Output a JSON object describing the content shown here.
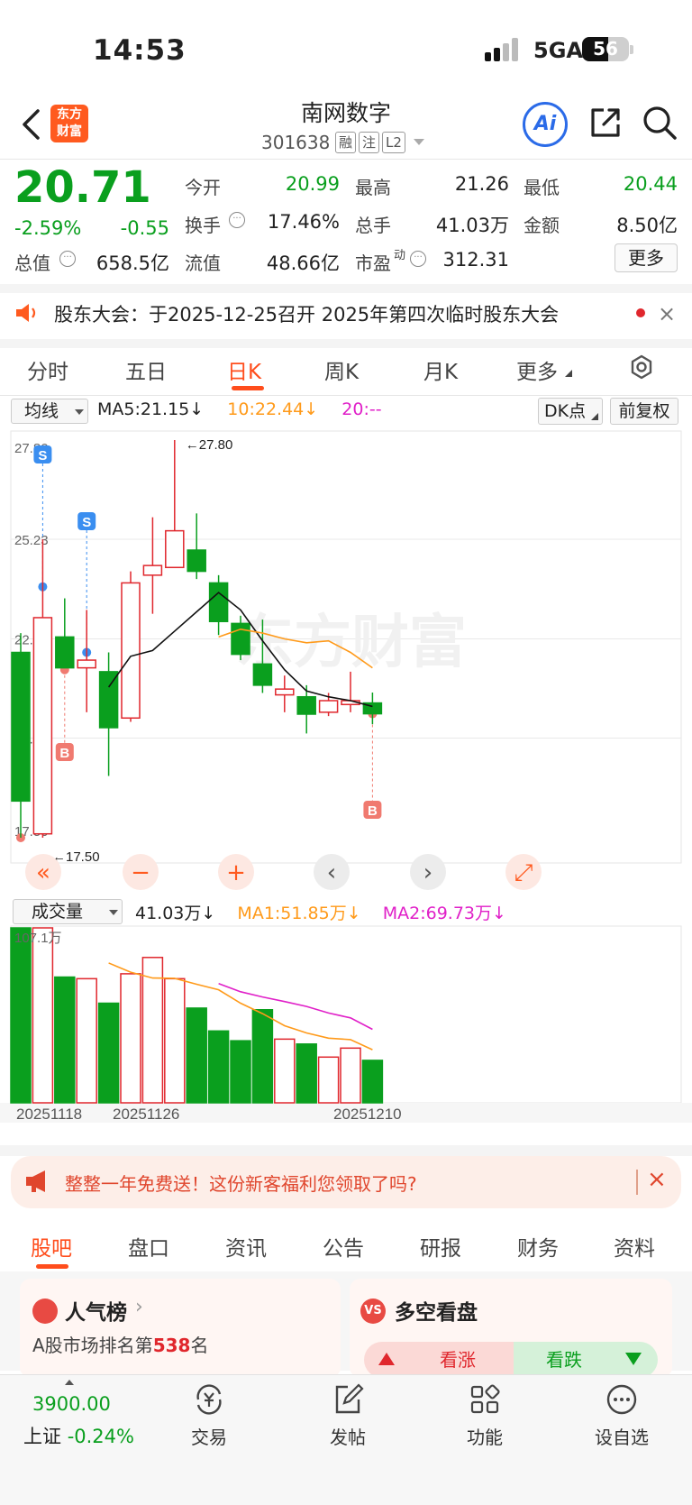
{
  "status": {
    "time": "14:53",
    "network": "5GA",
    "battery": "56",
    "battery_level": 0.56
  },
  "header": {
    "logo": [
      "东方",
      "财富"
    ],
    "stock_name": "南网数字",
    "stock_code": "301638",
    "tags": [
      "融",
      "注",
      "L2"
    ],
    "ai_label": "Ai"
  },
  "quote": {
    "price": "20.71",
    "change_pct": "-2.59%",
    "change_val": "-0.55",
    "mktcap_label": "总值",
    "mktcap_value": "658.5亿",
    "rows": [
      [
        {
          "label": "今开",
          "value": "20.99",
          "tone": "down"
        },
        {
          "label": "最高",
          "value": "21.26",
          "tone": "plain"
        },
        {
          "label": "最低",
          "value": "20.44",
          "tone": "down"
        }
      ],
      [
        {
          "label": "换手",
          "value": "17.46%",
          "tone": "plain"
        },
        {
          "label": "总手",
          "value": "41.03万",
          "tone": "plain"
        },
        {
          "label": "金额",
          "value": "8.50亿",
          "tone": "plain"
        }
      ],
      [
        {
          "label": "流值",
          "value": "48.66亿",
          "tone": "plain"
        },
        {
          "label": "市盈",
          "sup": "动",
          "value": "312.31",
          "tone": "plain"
        }
      ]
    ],
    "more_label": "更多"
  },
  "notice": {
    "text": "股东大会：于2025-12-25召开 2025年第四次临时股东大会",
    "close": "×"
  },
  "chart_tabs": {
    "items": [
      "分时",
      "五日",
      "日K",
      "周K",
      "月K",
      "更多"
    ],
    "active": 2
  },
  "chart_toolbar": {
    "ma_select": "均线",
    "ma5": "MA5:21.15",
    "ma10": "10:22.44",
    "ma20": "20:--",
    "arrow": "↓",
    "dk_label": "DK点",
    "adjust_label": "前复权",
    "vol_select": "成交量",
    "vol_value": "41.03万",
    "vol_ma1": "MA1:51.85万",
    "vol_ma2": "MA2:69.73万"
  },
  "colors": {
    "up": "#e0272d",
    "down": "#0a9f1e",
    "ma5": "#111111",
    "ma10": "#ff9a1a",
    "ma20": "#e020c8",
    "accent": "#ff4d1c"
  },
  "chart_data": [
    {
      "type": "candlestick",
      "watermark": "东方财富",
      "ylim": [
        17.5,
        27.8
      ],
      "y_ticks": [
        "27.80",
        "25.23",
        "22.65",
        "20.08",
        "17.50"
      ],
      "high_label": "←27.80",
      "low_label": "17.50←",
      "candles": [
        {
          "o": 22.3,
          "h": 22.8,
          "l": 17.5,
          "c": 18.45
        },
        {
          "o": 17.6,
          "h": 25.23,
          "l": 17.5,
          "c": 23.2
        },
        {
          "o": 22.7,
          "h": 23.7,
          "l": 22.1,
          "c": 21.9
        },
        {
          "o": 21.9,
          "h": 23.4,
          "l": 20.75,
          "c": 22.1
        },
        {
          "o": 21.8,
          "h": 22.3,
          "l": 19.1,
          "c": 20.35
        },
        {
          "o": 20.6,
          "h": 24.4,
          "l": 20.5,
          "c": 24.1
        },
        {
          "o": 24.3,
          "h": 25.8,
          "l": 23.3,
          "c": 24.55
        },
        {
          "o": 24.5,
          "h": 27.8,
          "l": 24.5,
          "c": 25.45
        },
        {
          "o": 24.95,
          "h": 25.9,
          "l": 24.2,
          "c": 24.4
        },
        {
          "o": 24.1,
          "h": 24.3,
          "l": 22.75,
          "c": 23.1
        },
        {
          "o": 23.05,
          "h": 23.25,
          "l": 22.1,
          "c": 22.25
        },
        {
          "o": 22.0,
          "h": 23.15,
          "l": 21.25,
          "c": 21.45
        },
        {
          "o": 21.2,
          "h": 21.7,
          "l": 20.75,
          "c": 21.35
        },
        {
          "o": 21.15,
          "h": 21.45,
          "l": 20.2,
          "c": 20.7
        },
        {
          "o": 20.75,
          "h": 21.25,
          "l": 20.65,
          "c": 21.05
        },
        {
          "o": 20.95,
          "h": 21.8,
          "l": 20.75,
          "c": 21.05
        },
        {
          "o": 20.99,
          "h": 21.26,
          "l": 20.44,
          "c": 20.71
        }
      ],
      "ma5": [
        null,
        null,
        null,
        null,
        21.4,
        22.2,
        22.35,
        22.85,
        23.35,
        23.85,
        23.4,
        22.6,
        21.85,
        21.3,
        21.15,
        21.05,
        20.9
      ],
      "ma10": [
        null,
        null,
        null,
        null,
        null,
        null,
        null,
        null,
        null,
        22.7,
        22.9,
        22.8,
        22.65,
        22.55,
        22.6,
        22.3,
        21.9
      ],
      "markers": [
        {
          "index": 1,
          "type": "S"
        },
        {
          "index": 3,
          "type": "S"
        },
        {
          "index": 0,
          "type": "B"
        },
        {
          "index": 2,
          "type": "B"
        },
        {
          "index": 16,
          "type": "B"
        }
      ],
      "controls": [
        "«",
        "−",
        "+",
        "‹",
        "›",
        "⤢"
      ]
    },
    {
      "type": "bar",
      "title": "成交量",
      "max_label": "107.1万",
      "x_labels": [
        "20251118",
        "20251126",
        "20251210"
      ],
      "values": [
        107.1,
        107.1,
        77.0,
        76.0,
        61.0,
        79.0,
        89.0,
        76.0,
        58.0,
        44.0,
        38.0,
        57.0,
        39.0,
        36.0,
        28.0,
        33.5,
        26.0
      ],
      "ma1": [
        null,
        null,
        null,
        null,
        85.6,
        80.0,
        76.4,
        76.2,
        72.6,
        69.2,
        61.0,
        54.6,
        47.2,
        42.8,
        39.6,
        38.7,
        32.5
      ],
      "ma2": [
        null,
        null,
        null,
        null,
        null,
        null,
        null,
        null,
        null,
        73.0,
        68.0,
        64.8,
        62.0,
        59.0,
        55.0,
        52.0,
        45.0
      ]
    }
  ],
  "promo": {
    "text": "整整一年免费送！这份新客福利您领取了吗?",
    "close": "×"
  },
  "bottom_tabs": {
    "items": [
      "股吧",
      "盘口",
      "资讯",
      "公告",
      "研报",
      "财务",
      "资料"
    ],
    "active": 0
  },
  "cards": {
    "popularity": {
      "title": "人气榜",
      "rank_prefix": "A股市场排名第",
      "rank": "538",
      "rank_suffix": "名"
    },
    "bull_bear": {
      "title": "多空看盘",
      "icon": "VS",
      "bull": "看涨",
      "bear": "看跌"
    }
  },
  "index": {
    "value": "3900.00",
    "name": "上证",
    "change": "-0.24%"
  },
  "nav": [
    {
      "icon": "trade-icon",
      "label": "交易"
    },
    {
      "icon": "compose-icon",
      "label": "发帖"
    },
    {
      "icon": "function-icon",
      "label": "功能"
    },
    {
      "icon": "watchlist-icon",
      "label": "设自选"
    }
  ]
}
